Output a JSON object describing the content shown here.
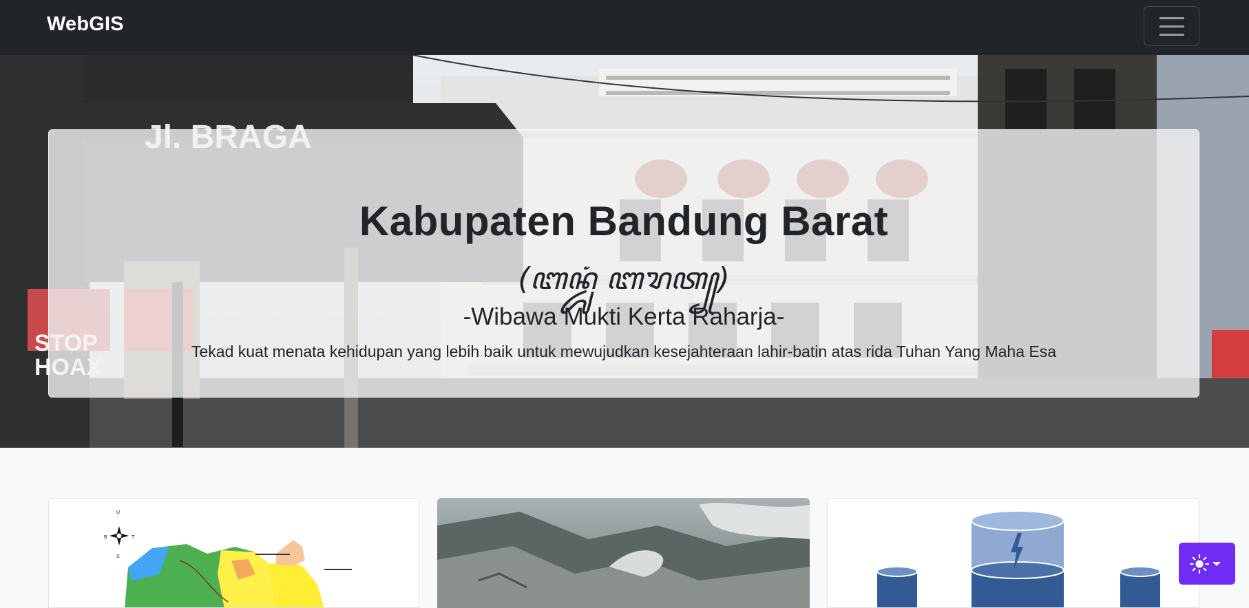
{
  "navbar": {
    "brand": "WebGIS",
    "menu_icon": "hamburger-menu-icon"
  },
  "hero": {
    "title": "Kabupaten Bandung Barat",
    "script_text": "(ꦧꦤ꧀ꦢꦸꦁ ꦧꦫꦠ꧀)",
    "motto": "-Wibawa Mukti Kerta Raharja-",
    "description": "Tekad kuat menata kehidupan yang lebih baik untuk mewujudkan kesejahteraan lahir-batin atas rida Tuhan Yang Maha Esa",
    "background_image": "street-photo-jl-braga",
    "sign_text": "Jl. BRAGA",
    "poster_text": [
      "STOP",
      "HOAX"
    ]
  },
  "cards": [
    {
      "image": "regional-map-image",
      "compass_labels": [
        "U",
        "S",
        "B",
        "T"
      ]
    },
    {
      "image": "volcano-crater-photo"
    },
    {
      "image": "database-icon-illustration"
    }
  ],
  "theme_toggle": {
    "icon": "sun-icon",
    "caret": "caret-down-icon"
  },
  "colors": {
    "navbar": "#212529",
    "page_bg": "#f8f9fa",
    "theme_button": "#6f2cf5",
    "text": "#212529"
  }
}
